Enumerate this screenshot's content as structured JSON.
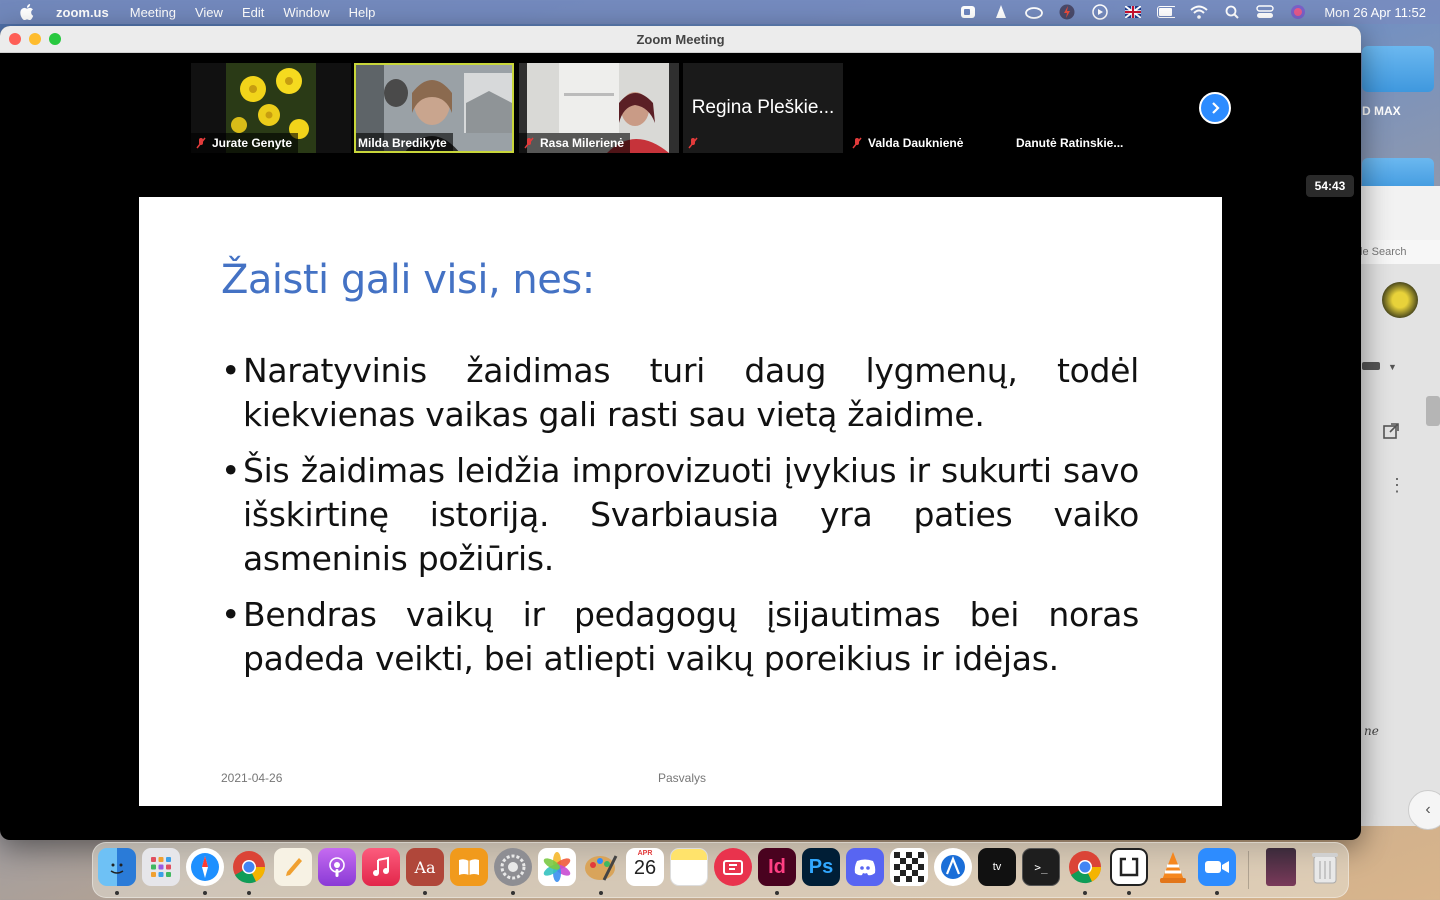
{
  "menubar": {
    "app_name": "zoom.us",
    "items": [
      "Meeting",
      "View",
      "Edit",
      "Window",
      "Help"
    ],
    "clock": "Mon 26 Apr  11:52"
  },
  "desktop": {
    "folder_label": "D MAX",
    "bg_search_text": "le Search",
    "bg_italic": "ne"
  },
  "zoom": {
    "window_title": "Zoom Meeting",
    "timer": "54:43",
    "participants": [
      {
        "name": "Jurate Genyte",
        "muted": true
      },
      {
        "name": "Milda Bredikyte",
        "muted": false,
        "active": true
      },
      {
        "name": "Rasa Milerienė",
        "muted": true
      },
      {
        "name": "",
        "big_name": "Regina Pleškie...",
        "muted": true
      },
      {
        "name": "Valda Dauknienė",
        "muted": true
      },
      {
        "name": "Danutė Ratinskie...",
        "muted": false
      }
    ]
  },
  "slide": {
    "title": "Žaisti gali visi, nes:",
    "bullets": [
      "Naratyvinis žaidimas turi daug lygmenų, todėl kiekvienas vaikas gali rasti sau vietą žaidime.",
      "Šis žaidimas leidžia improvizuoti  įvykius ir sukurti savo išskirtinę istoriją. Svarbiausia yra paties vaiko asmeninis požiūris.",
      "Bendras vaikų ir pedagogų įsijautimas bei noras padeda veikti, bei atliepti vaikų poreikius ir idėjas."
    ],
    "footer_date": "2021-04-26",
    "footer_center": "Pasvalys"
  },
  "dock": {
    "calendar_month": "APR",
    "calendar_day": "26",
    "indesign_label": "Id",
    "photoshop_label": "Ps",
    "dictionary_label": "Aa",
    "apps": [
      "finder",
      "launchpad",
      "safari",
      "chrome",
      "pages",
      "podcasts",
      "music",
      "dictionary",
      "books",
      "system-preferences",
      "photos",
      "paintbrush",
      "calendar",
      "notes",
      "speedtest",
      "indesign",
      "photoshop",
      "discord",
      "chess",
      "xcode-instruments",
      "apple-tv",
      "terminal",
      "chrome",
      "screen-capture",
      "vlc",
      "zoom",
      "photo-thumbnail",
      "trash"
    ]
  }
}
